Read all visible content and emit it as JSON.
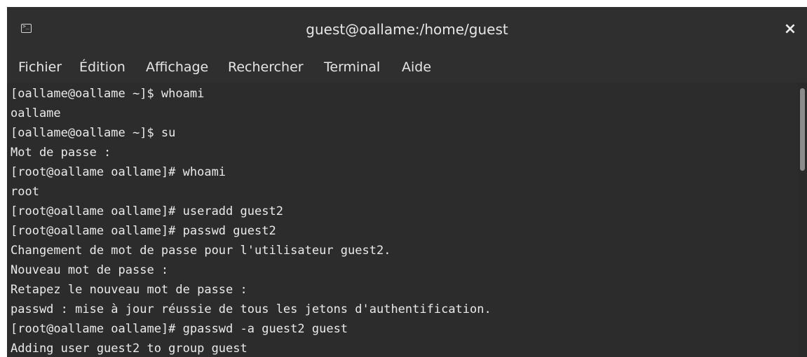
{
  "window": {
    "title": "guest@oallame:/home/guest",
    "close_label": "×",
    "app_icon": "terminal-icon"
  },
  "menu": {
    "items": [
      {
        "label": "Fichier"
      },
      {
        "label": "Édition"
      },
      {
        "label": "Affichage"
      },
      {
        "label": "Rechercher"
      },
      {
        "label": "Terminal"
      },
      {
        "label": "Aide"
      }
    ]
  },
  "terminal": {
    "lines": [
      "[oallame@oallame ~]$ whoami",
      "oallame",
      "[oallame@oallame ~]$ su",
      "Mot de passe :",
      "[root@oallame oallame]# whoami",
      "root",
      "[root@oallame oallame]# useradd guest2",
      "[root@oallame oallame]# passwd guest2",
      "Changement de mot de passe pour l'utilisateur guest2.",
      "Nouveau mot de passe :",
      "Retapez le nouveau mot de passe :",
      "passwd : mise à jour réussie de tous les jetons d'authentification.",
      "[root@oallame oallame]# gpasswd -a guest2 guest",
      "Adding user guest2 to group guest"
    ]
  },
  "colors": {
    "background": "#2c2c2c",
    "text": "#eaeaea",
    "titlebar": "#2f2f2f"
  }
}
